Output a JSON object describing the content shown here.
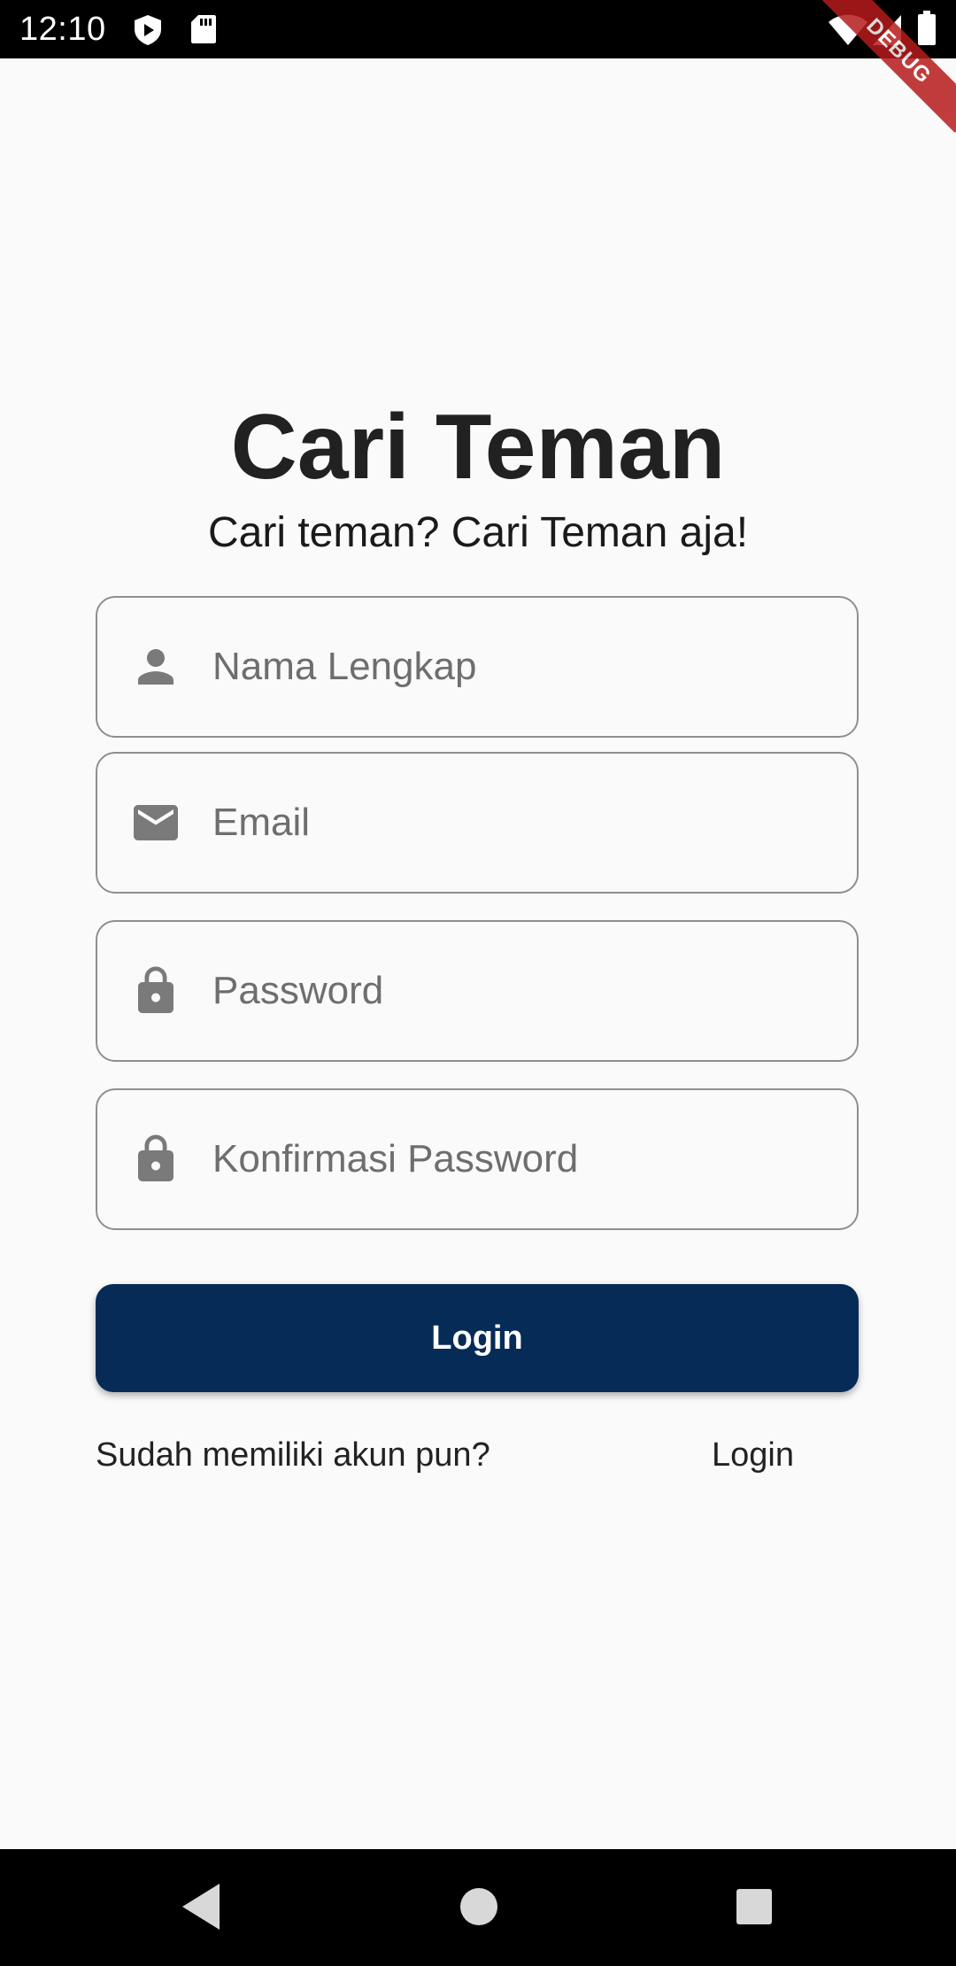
{
  "status_bar": {
    "time": "12:10",
    "icons": [
      "shield-icon",
      "sd-card-icon",
      "wifi-icon",
      "signal-icon",
      "battery-icon"
    ],
    "background": "#000000"
  },
  "debug_banner": {
    "label": "DEBUG",
    "color": "#b71c1c"
  },
  "app": {
    "title": "Cari Teman",
    "subtitle": "Cari teman? Cari Teman aja!"
  },
  "form": {
    "fields": [
      {
        "icon": "person-icon",
        "placeholder": "Nama Lengkap",
        "value": ""
      },
      {
        "icon": "mail-icon",
        "placeholder": "Email",
        "value": ""
      },
      {
        "icon": "lock-icon",
        "placeholder": "Password",
        "value": ""
      },
      {
        "icon": "lock-icon",
        "placeholder": "Konfirmasi Password",
        "value": ""
      }
    ],
    "submit_label": "Login",
    "submit_color": "#072b57"
  },
  "footer": {
    "prompt": "Sudah memiliki akun pun?",
    "link": "Login"
  },
  "nav_bar": {
    "buttons": [
      "back-icon",
      "home-icon",
      "recents-icon"
    ]
  }
}
